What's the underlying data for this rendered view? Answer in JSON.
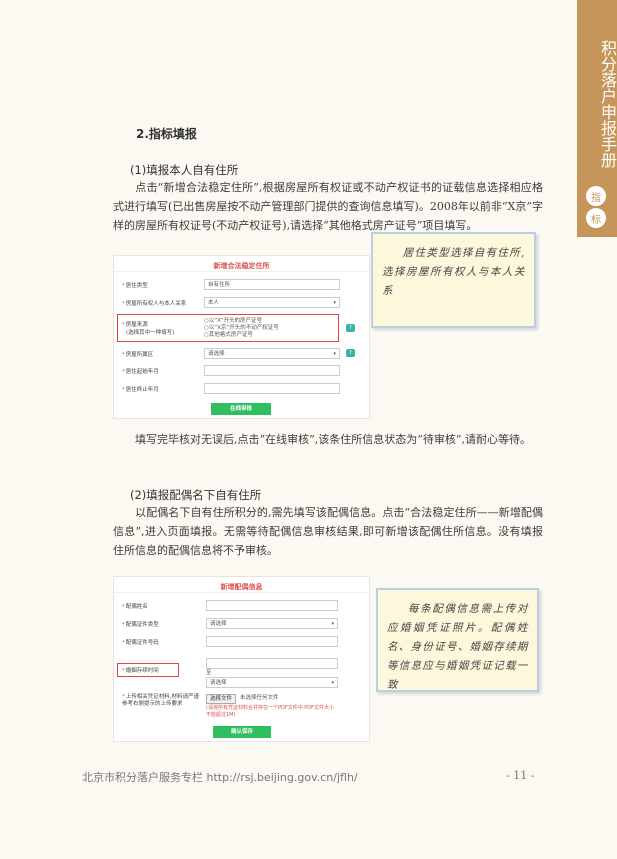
{
  "side_tab": {
    "title": "积分落户申报手册",
    "badges": [
      "指",
      "标"
    ]
  },
  "section_title": "2.指标填报",
  "sub1": {
    "title": "(1)填报本人自有住所",
    "para": "点击“新增合法稳定住所”,根据房屋所有权证或不动产权证书的证载信息选择相应格式进行填写(已出售房屋按不动产管理部门提供的查询信息填写)。2008年以前非“X京”字样的房屋所有权证号(不动产权证号),请选择“其他格式房产证号”项目填写。",
    "after": "填写完毕核对无误后,点击“在线审核”,该条住所信息状态为“待审核”,请耐心等待。"
  },
  "form1": {
    "title": "新增合法稳定住所",
    "rows": [
      {
        "label": "居住类型",
        "value": "自有住所"
      },
      {
        "label": "房屋所有权人与本人关系",
        "value": "本人"
      },
      {
        "label": "房屋所属区",
        "value": "请选择"
      },
      {
        "label": "居住起始年月",
        "value": ""
      },
      {
        "label": "居住终止年月",
        "value": ""
      }
    ],
    "house_source_label": "房屋来源",
    "house_source_note": "(选择其中一种填写)",
    "options": [
      "以“X”开头的房产证号",
      "以“X京”开头的不动产权证号",
      "其他格式房产证号"
    ],
    "submit": "在线审核",
    "help": "?"
  },
  "callout1": "居住类型选择自有住所,选择房屋所有权人与本人关系",
  "sub2": {
    "title": "(2)填报配偶名下自有住所",
    "para": "以配偶名下自有住所积分的,需先填写该配偶信息。点击“合法稳定住所——新增配偶信息”,进入页面填报。无需等待配偶信息审核结果,即可新增该配偶住所信息。没有填报住所信息的配偶信息将不予审核。"
  },
  "form2": {
    "title": "新增配偶信息",
    "rows": [
      {
        "label": "配偶姓名",
        "value": ""
      },
      {
        "label": "配偶证件类型",
        "value": "请选择"
      },
      {
        "label": "配偶证件号码",
        "value": ""
      }
    ],
    "marriage_label": "婚姻存续时间",
    "marriage_from": "至",
    "marriage_select": "请选择",
    "upload_label": "上传相关凭证材料,材料请严谨参考右侧提示的上传要求",
    "upload_button": "选择文件",
    "upload_status": "未选择任何文件",
    "upload_note": "(请将所有凭证材料合并存在一个PDF文件中,PDF文件大小不能超过1M)",
    "submit": "确认保存"
  },
  "callout2": "每条配偶信息需上传对应婚姻凭证照片。配偶姓名、身份证号、婚姻存续期等信息应与婚姻凭证记载一致",
  "footer": {
    "left": "北京市积分落户服务专栏 http://rsj.beijing.gov.cn/jflh/",
    "page": "- 11 -"
  }
}
